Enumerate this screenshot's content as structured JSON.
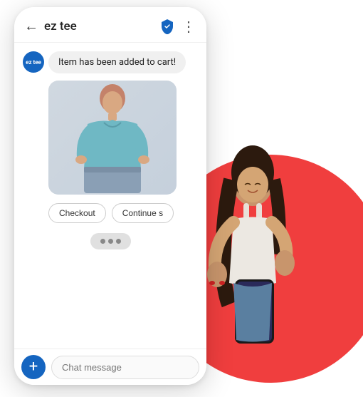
{
  "header": {
    "title": "ez tee",
    "back_label": "←",
    "more_label": "⋮"
  },
  "chat": {
    "bot_avatar_label": "ez tee",
    "message1": "Item has been added to cart!",
    "button1": "Checkout",
    "button2": "Continue s",
    "typing_dots": "...",
    "input_placeholder": "Chat message"
  },
  "add_button_label": "+",
  "colors": {
    "accent": "#1565c0",
    "red_circle": "#f03e3e",
    "chat_bg": "#f0f0f0"
  }
}
